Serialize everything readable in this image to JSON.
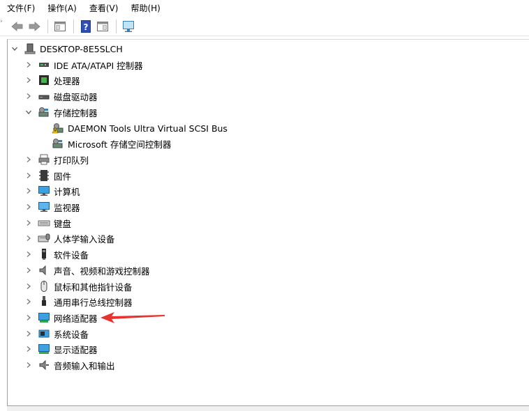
{
  "menu": [
    "文件(F)",
    "操作(A)",
    "查看(V)",
    "帮助(H)"
  ],
  "toolbar": {
    "buttons": [
      "back-icon",
      "forward-icon",
      "properties-icon",
      "help-icon",
      "action-pane-icon",
      "monitor-icon"
    ]
  },
  "tree": {
    "root": "DESKTOP-8E5SLCH",
    "nodes": [
      {
        "label": "IDE ATA/ATAPI 控制器",
        "icon": "ide-controller-icon",
        "expanded": false
      },
      {
        "label": "处理器",
        "icon": "processor-icon",
        "expanded": false
      },
      {
        "label": "磁盘驱动器",
        "icon": "disk-drive-icon",
        "expanded": false
      },
      {
        "label": "存储控制器",
        "icon": "storage-controller-icon",
        "expanded": true,
        "children": [
          {
            "label": "DAEMON Tools Ultra Virtual SCSI Bus",
            "icon": "scsi-warning-icon"
          },
          {
            "label": "Microsoft 存储空间控制器",
            "icon": "storage-controller-icon"
          }
        ]
      },
      {
        "label": "打印队列",
        "icon": "printer-icon",
        "expanded": false
      },
      {
        "label": "固件",
        "icon": "firmware-icon",
        "expanded": false
      },
      {
        "label": "计算机",
        "icon": "computer-icon",
        "expanded": false
      },
      {
        "label": "监视器",
        "icon": "monitor-icon",
        "expanded": false
      },
      {
        "label": "键盘",
        "icon": "keyboard-icon",
        "expanded": false
      },
      {
        "label": "人体学输入设备",
        "icon": "hid-icon",
        "expanded": false
      },
      {
        "label": "软件设备",
        "icon": "software-device-icon",
        "expanded": false
      },
      {
        "label": "声音、视频和游戏控制器",
        "icon": "speaker-icon",
        "expanded": false
      },
      {
        "label": "鼠标和其他指针设备",
        "icon": "mouse-icon",
        "expanded": false
      },
      {
        "label": "通用串行总线控制器",
        "icon": "usb-icon",
        "expanded": false
      },
      {
        "label": "网络适配器",
        "icon": "network-adapter-icon",
        "expanded": false
      },
      {
        "label": "系统设备",
        "icon": "system-device-icon",
        "expanded": false
      },
      {
        "label": "显示适配器",
        "icon": "display-adapter-icon",
        "expanded": false
      },
      {
        "label": "音频输入和输出",
        "icon": "audio-io-icon",
        "expanded": false
      }
    ]
  },
  "annotation": {
    "color": "#e8322d",
    "points_to": "网络适配器"
  }
}
